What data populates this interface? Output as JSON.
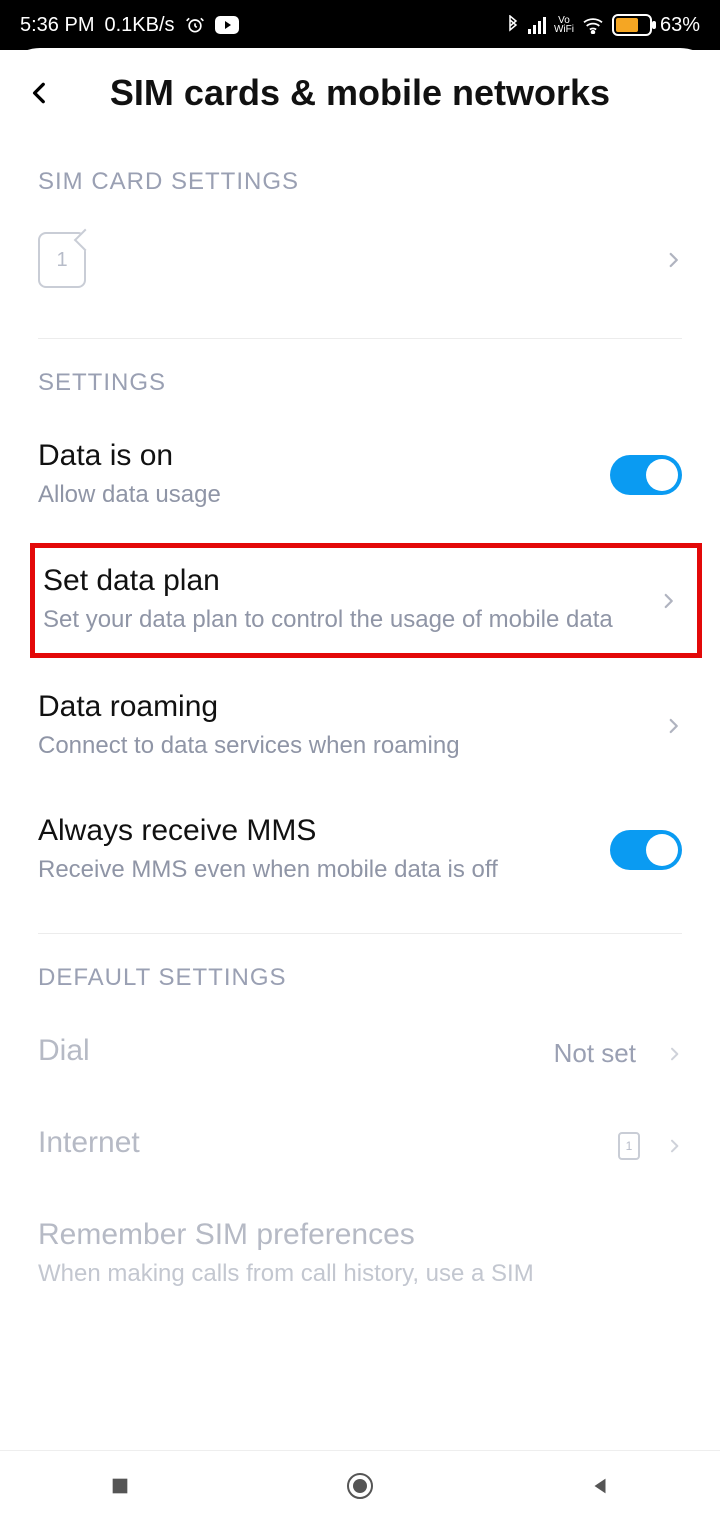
{
  "status": {
    "time": "5:36 PM",
    "net_speed": "0.1KB/s",
    "battery_pct": "63%",
    "vowifi": "Vo\nWiFi"
  },
  "header": {
    "title": "SIM cards & mobile networks"
  },
  "sections": {
    "sim_card": {
      "header": "SIM CARD SETTINGS",
      "slot_label": "1"
    },
    "settings": {
      "header": "SETTINGS",
      "data_on": {
        "title": "Data is on",
        "sub": "Allow data usage"
      },
      "set_plan": {
        "title": "Set data plan",
        "sub": "Set your data plan to control the usage of mobile data"
      },
      "roaming": {
        "title": "Data roaming",
        "sub": "Connect to data services when roaming"
      },
      "mms": {
        "title": "Always receive MMS",
        "sub": "Receive MMS even when mobile data is off"
      }
    },
    "defaults": {
      "header": "DEFAULT SETTINGS",
      "dial": {
        "title": "Dial",
        "value": "Not set"
      },
      "internet": {
        "title": "Internet",
        "value_sim": "1"
      },
      "remember": {
        "title": "Remember SIM preferences",
        "sub": "When making calls from call history, use a SIM"
      }
    }
  }
}
